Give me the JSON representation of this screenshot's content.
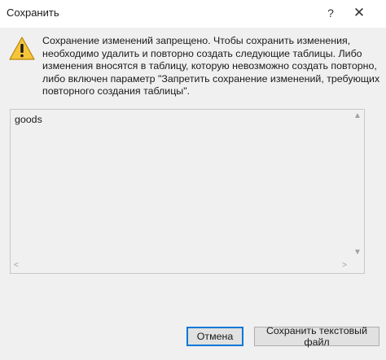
{
  "window": {
    "title": "Сохранить",
    "help_label": "?",
    "close_label": "✕"
  },
  "message": {
    "lines": [
      "Сохранение изменений запрещено. Чтобы сохранить изменения,",
      "необходимо удалить и повторно создать следующие таблицы. Либо",
      "изменения вносятся в таблицу, которую невозможно создать повторно,",
      "либо включен параметр \"Запретить сохранение изменений, требующих",
      "повторного создания таблицы\"."
    ]
  },
  "list": {
    "text": "goods",
    "scroll_up": "▲",
    "scroll_down": "▼",
    "scroll_left": "<",
    "scroll_right": ">"
  },
  "buttons": {
    "cancel_label": "Отмена",
    "save_text_file_label": "Сохранить текстовый файл"
  },
  "icons": {
    "warning": "warning-icon",
    "warning_color": "#f6c53a"
  }
}
